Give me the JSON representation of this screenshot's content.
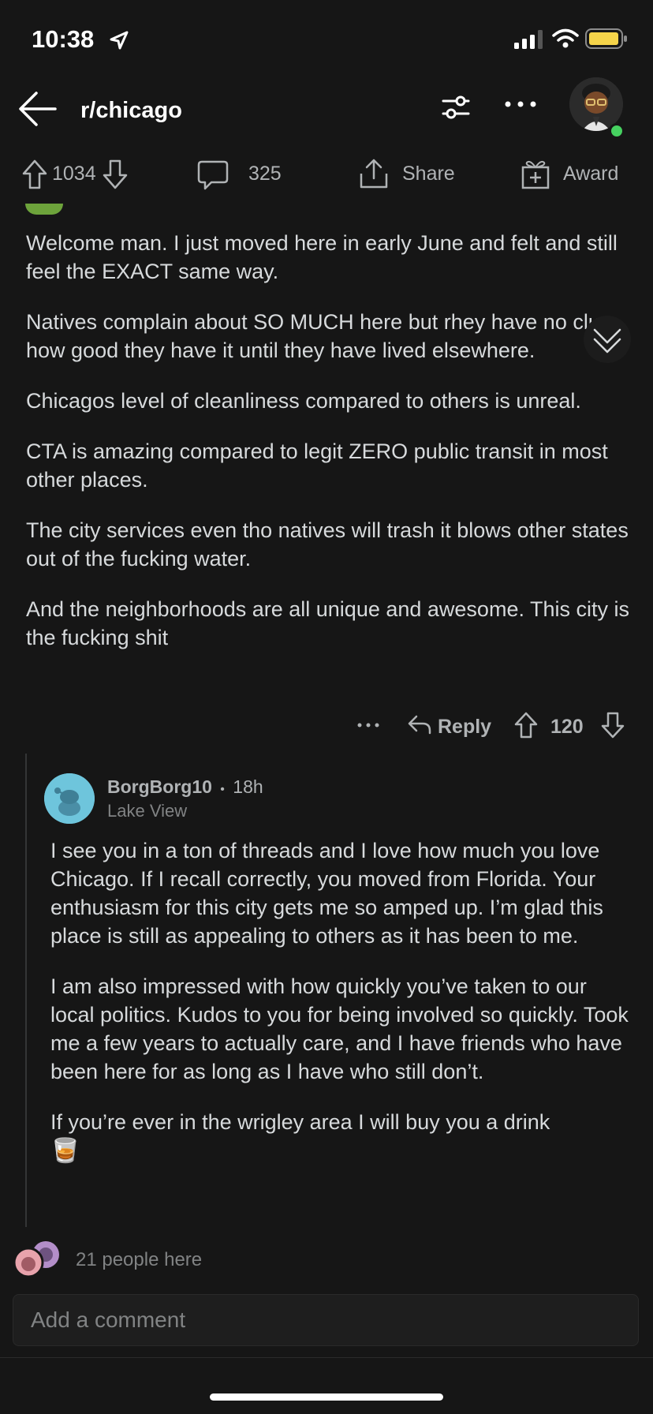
{
  "status_bar": {
    "time": "10:38"
  },
  "header": {
    "title": "r/chicago"
  },
  "actions": {
    "upvotes": "1034",
    "comments": "325",
    "share_label": "Share",
    "award_label": "Award"
  },
  "comment": {
    "paragraphs": [
      "Welcome man. I just moved here in early June and felt and still feel the EXACT same way.",
      "Natives complain about SO MUCH here but rhey have no clue how good they have it until they have lived elsewhere.",
      "Chicagos level of cleanliness compared to others is unreal.",
      "CTA is amazing compared to legit ZERO public transit in most other places.",
      "The city services even tho natives will trash it blows other states out of the fucking water.",
      "And the neighborhoods are all unique and awesome. This city is the fucking shit"
    ],
    "reply_label": "Reply",
    "score": "120"
  },
  "reply": {
    "username": "BorgBorg10",
    "separator": "•",
    "age": "18h",
    "flair": "Lake View",
    "paragraphs": [
      "I see you in a ton of threads and I love how much you love Chicago. If I recall correctly, you moved from Florida. Your enthusiasm for this city gets me so amped up. I’m glad this place is still as appealing to others as it has been to me.",
      "I am also impressed with how quickly you’ve taken to our local politics. Kudos to you for being involved so quickly. Took me a few years to actually care, and I have friends who have been here for as long as I have who still don’t.",
      "If you’re ever in the wrigley area I will buy you a drink"
    ],
    "emoji": "🥃"
  },
  "presence": {
    "label": "21 people here"
  },
  "composer": {
    "placeholder": "Add a comment"
  },
  "colors": {
    "background": "#161616",
    "text": "#d7dadc",
    "muted": "#818384",
    "online": "#46d160"
  }
}
